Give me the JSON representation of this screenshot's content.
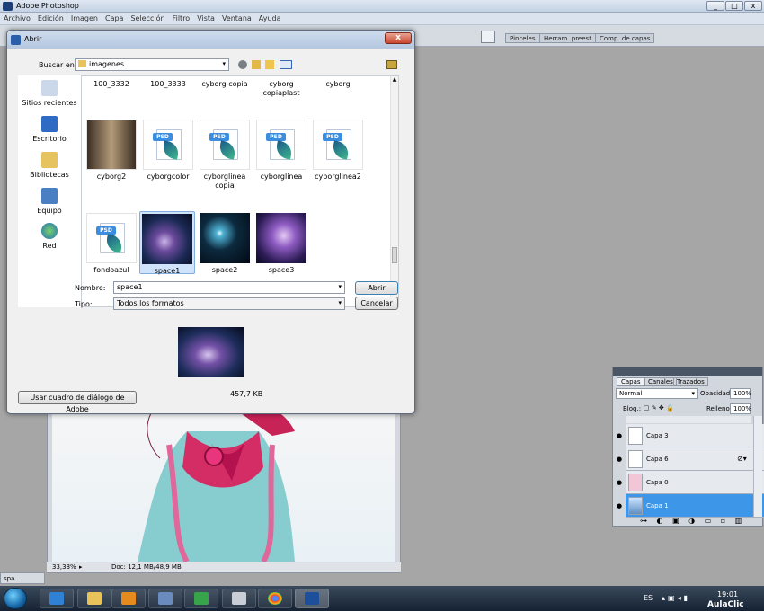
{
  "app": {
    "title": "Adobe Photoshop",
    "win_buttons": [
      "_",
      "□",
      "x"
    ]
  },
  "menu": [
    "Archivo",
    "Edición",
    "Imagen",
    "Capa",
    "Selección",
    "Filtro",
    "Vista",
    "Ventana",
    "Ayuda"
  ],
  "panel_tabs": [
    "Pinceles",
    "Herram. preest.",
    "Comp. de capas"
  ],
  "dialog": {
    "title": "Abrir",
    "close": "x",
    "look_in_label": "Buscar en:",
    "look_in_value": "imagenes",
    "places": [
      {
        "label": "Sitios recientes",
        "icon": "recent-places-icon"
      },
      {
        "label": "Escritorio",
        "icon": "desktop-icon"
      },
      {
        "label": "Bibliotecas",
        "icon": "libraries-icon"
      },
      {
        "label": "Equipo",
        "icon": "computer-icon"
      },
      {
        "label": "Red",
        "icon": "network-icon"
      }
    ],
    "files_row0": [
      "100_3332",
      "100_3333",
      "cyborg copia",
      "cyborg copiaplast",
      "cyborg"
    ],
    "files_row1": [
      "cyborg2",
      "cyborgcolor",
      "cyborglinea copia",
      "cyborglinea",
      "cyborglinea2"
    ],
    "files_row2": [
      "fondoazul",
      "space1",
      "space2",
      "space3"
    ],
    "selected_file": "space1",
    "name_label": "Nombre:",
    "name_value": "space1",
    "type_label": "Tipo:",
    "type_value": "Todos los formatos",
    "open_button": "Abrir",
    "cancel_button": "Cancelar",
    "adobe_dialog_button": "Usar cuadro de diálogo de Adobe",
    "file_size": "457,7 KB"
  },
  "document": {
    "zoom": "33,33%",
    "doc_info": "Doc: 12,1 MB/48,9 MB",
    "tab": "spa..."
  },
  "layers": {
    "tabs": [
      "Capas",
      "Canales",
      "Trazados"
    ],
    "blend_mode": "Normal",
    "opacity_label": "Opacidad:",
    "opacity": "100%",
    "lock_label": "Bloq.:",
    "fill_label": "Relleno:",
    "fill": "100%",
    "items": [
      "Capa 3",
      "Capa 6",
      "Capa 0",
      "Capa 1"
    ],
    "selected": "Capa 1"
  },
  "taskbar": {
    "lang": "ES",
    "time": "19:01",
    "watermark": "AulaClic"
  }
}
